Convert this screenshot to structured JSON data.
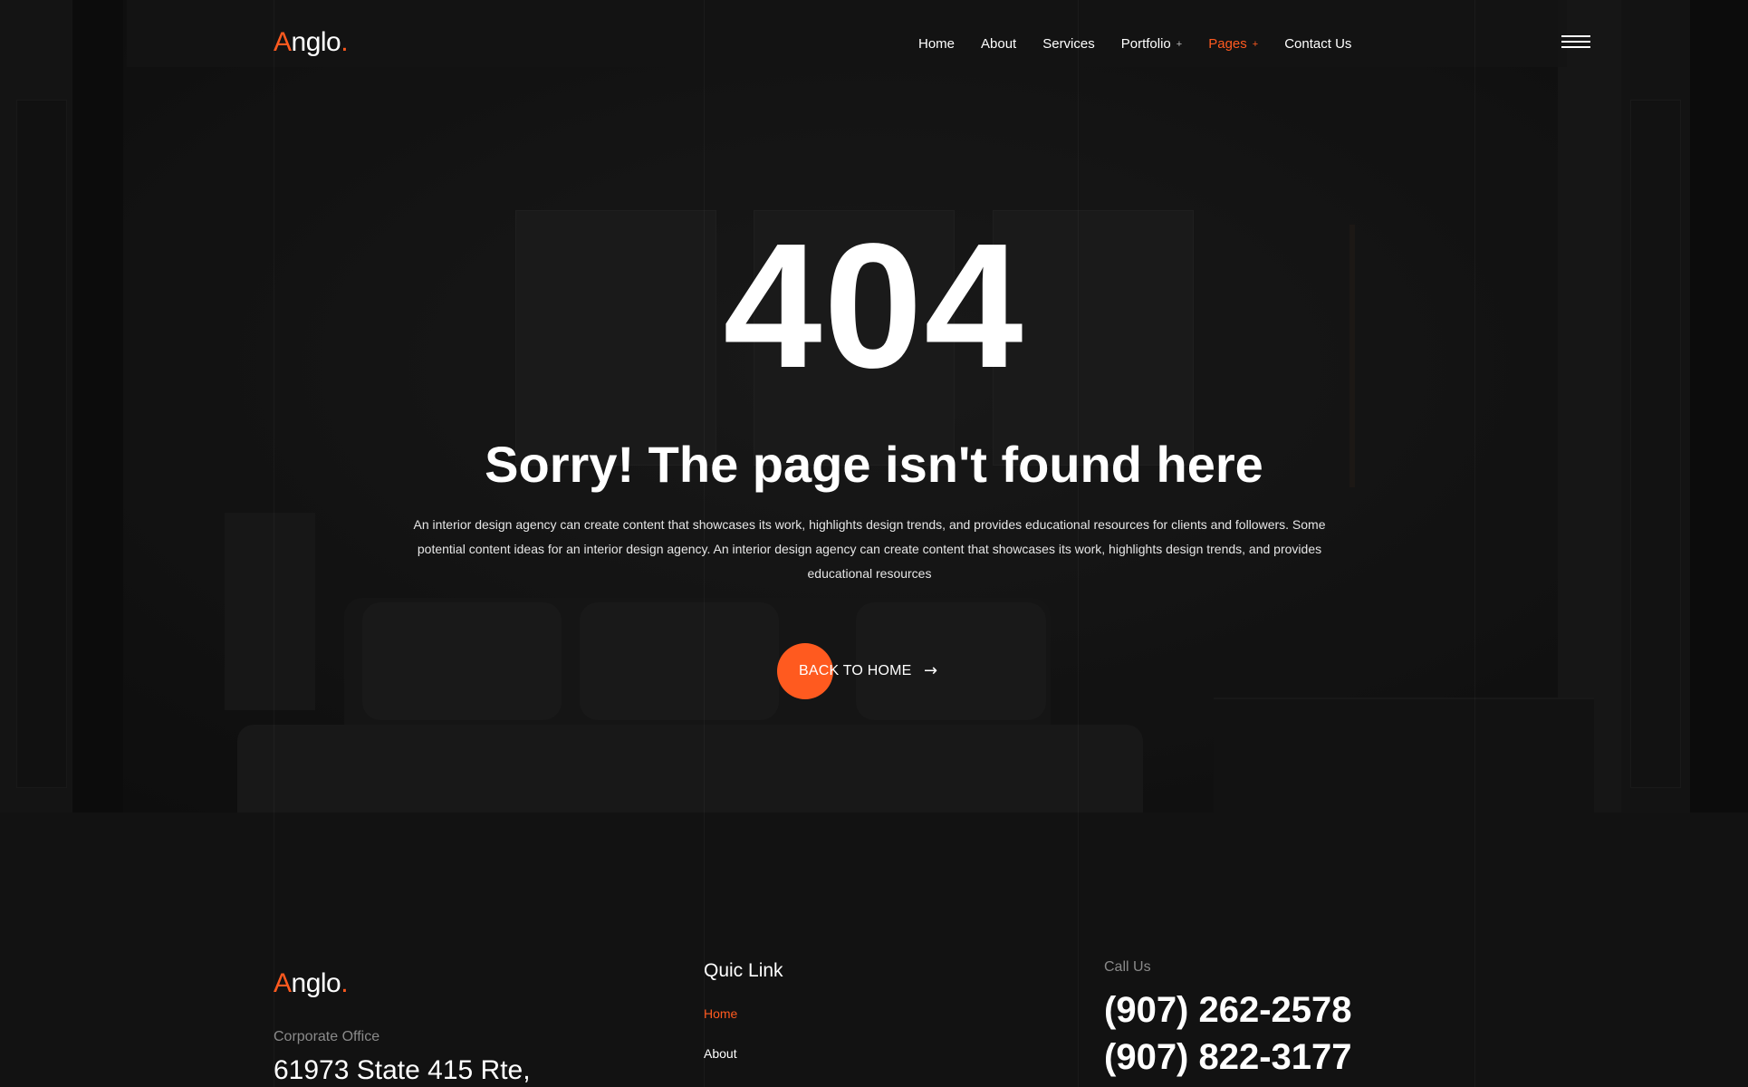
{
  "brand": {
    "name_first": "A",
    "name_rest": "nglo",
    "name_dot": ".",
    "accent": "#ff5a1f"
  },
  "nav": [
    {
      "label": "Home",
      "has_sub": false,
      "active": false
    },
    {
      "label": "About",
      "has_sub": false,
      "active": false
    },
    {
      "label": "Services",
      "has_sub": false,
      "active": false
    },
    {
      "label": "Portfolio",
      "has_sub": true,
      "active": false
    },
    {
      "label": "Pages",
      "has_sub": true,
      "active": true
    },
    {
      "label": "Contact Us",
      "has_sub": false,
      "active": false
    }
  ],
  "nav_sub_indicator": "+",
  "menu_icon": "hamburger-menu-icon",
  "hero": {
    "code": "404",
    "headline": "Sorry! The page isn't found here",
    "description": "An interior design agency can create content that showcases its work, highlights design trends, and provides educational resources for clients and followers. Some potential content ideas for an interior design agency. An interior design agency can create content that showcases its work, highlights design trends, and provides educational resources",
    "cta_label": "BACK TO HOME",
    "cta_icon": "arrow-right-icon"
  },
  "footer": {
    "corporate_label": "Corporate Office",
    "address_line": "61973 State 415 Rte,",
    "quick_link_title": "Quic Link",
    "quick_links": [
      {
        "label": "Home",
        "active": true
      },
      {
        "label": "About",
        "active": false
      }
    ],
    "call_label": "Call Us",
    "phones": [
      "(907) 262-2578",
      "(907) 822-3177"
    ]
  }
}
